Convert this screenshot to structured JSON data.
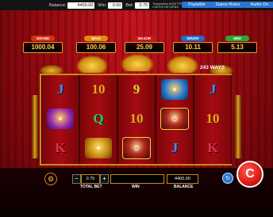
{
  "topbar": {
    "balance_label": "Balance:",
    "balance_value": "4400.00",
    "win_label": "Win:",
    "win_value": "0.00",
    "bet_label": "Bet:",
    "bet_value": "0.75",
    "note": "Temperation till\nBETTED LIMITED RETURNS",
    "paytable": "Paytable",
    "game_rules": "Game Rules",
    "audio": "Audio On"
  },
  "jackpots": [
    {
      "tag": "GRAND",
      "value": "1000.04",
      "color": "#d83010"
    },
    {
      "tag": "MAXI",
      "value": "100.06",
      "color": "#e08a10"
    },
    {
      "tag": "MAJOR",
      "value": "25.09",
      "color": "#c81818"
    },
    {
      "tag": "MINOR",
      "value": "10.11",
      "color": "#1e6ed2"
    },
    {
      "tag": "MINI",
      "value": "5.13",
      "color": "#2aa838"
    }
  ],
  "ways": "243 WAYS",
  "reels": [
    [
      {
        "t": "J",
        "k": "J"
      },
      {
        "t": "",
        "k": "pic-purple",
        "icon": "tiger-icon"
      },
      {
        "t": "K",
        "k": "K"
      }
    ],
    [
      {
        "t": "10",
        "k": "10"
      },
      {
        "t": "Q",
        "k": "Q"
      },
      {
        "t": "",
        "k": "pic-gold",
        "icon": "gold-ingot-icon"
      }
    ],
    [
      {
        "t": "9",
        "k": "9"
      },
      {
        "t": "10",
        "k": "10"
      },
      {
        "t": "",
        "k": "pic-god",
        "icon": "fortune-god-icon"
      }
    ],
    [
      {
        "t": "",
        "k": "pic-blue",
        "icon": "dragon-coin-icon"
      },
      {
        "t": "",
        "k": "pic-god",
        "icon": "fortune-god-icon"
      },
      {
        "t": "J",
        "k": "J"
      }
    ],
    [
      {
        "t": "J",
        "k": "J"
      },
      {
        "t": "10",
        "k": "10"
      },
      {
        "t": "K",
        "k": "K"
      }
    ]
  ],
  "controls": {
    "total_bet_value": "0.75",
    "total_bet_label": "TOTAL BET",
    "win_value": "",
    "win_label": "WIN",
    "balance_value": "4400.00",
    "balance_label": "BALANCE",
    "minus": "−",
    "plus": "+",
    "gear_glyph": "⚙",
    "auto_glyph": "↻",
    "spin_glyph": "C"
  }
}
